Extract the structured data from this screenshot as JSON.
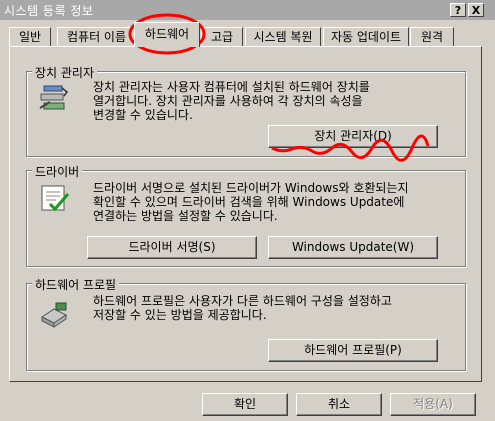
{
  "window": {
    "title": "시스템 등록 정보",
    "help_label": "?",
    "close_label": "X"
  },
  "tabs": [
    {
      "label": "일반"
    },
    {
      "label": "컴퓨터 이름"
    },
    {
      "label": "하드웨어"
    },
    {
      "label": "고급"
    },
    {
      "label": "시스템 복원"
    },
    {
      "label": "자동 업데이트"
    },
    {
      "label": "원격"
    }
  ],
  "groups": {
    "device_manager": {
      "title": "장치 관리자",
      "description_lines": [
        "장치 관리자는 사용자 컴퓨터에 설치된 하드웨어 장치를",
        "열거합니다. 장치 관리자를 사용하여 각 장치의 속성을",
        "변경할 수 있습니다."
      ],
      "button_label": "장치 관리자(D)"
    },
    "driver": {
      "title": "드라이버",
      "description_lines": [
        "드라이버 서명으로 설치된 드라이버가 Windows와 호환되는지",
        "확인할 수 있으며 드라이버 검색을 위해 Windows Update에",
        "연결하는 방법을 설정할 수 있습니다."
      ],
      "signing_button_label": "드라이버 서명(S)",
      "update_button_label": "Windows Update(W)"
    },
    "hardware_profile": {
      "title": "하드웨어 프로필",
      "description_lines": [
        "하드웨어 프로필은 사용자가 다른 하드웨어 구성을 설정하고",
        "저장할 수 있는 방법을 제공합니다."
      ],
      "button_label": "하드웨어 프로필(P)"
    }
  },
  "footer": {
    "ok_label": "확인",
    "cancel_label": "취소",
    "apply_label": "적용(A)"
  },
  "colors": {
    "dialog_bg": "#d4d0c8",
    "annotation_red": "#ff0000"
  }
}
